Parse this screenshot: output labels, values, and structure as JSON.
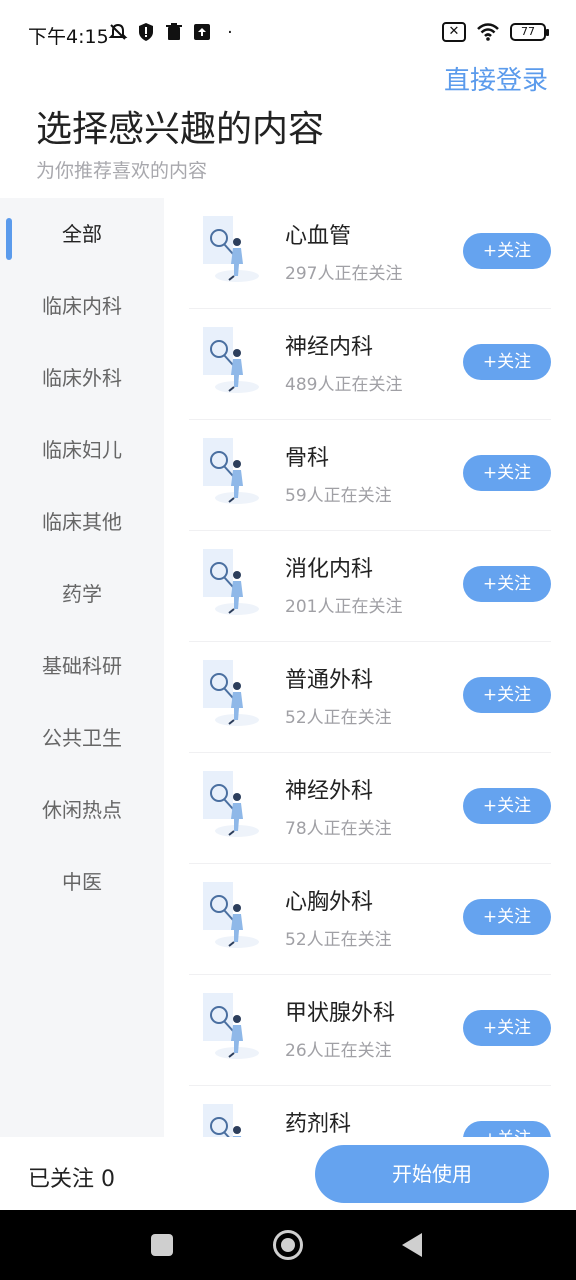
{
  "status_bar": {
    "time": "下午4:15",
    "battery": "77",
    "icons": [
      "muted-bell-icon",
      "shield-alert-icon",
      "trash-icon",
      "upload-icon",
      "dot-icon"
    ],
    "right_icons": [
      "sim-off-icon",
      "wifi-icon",
      "battery-icon"
    ]
  },
  "header": {
    "login_link": "直接登录",
    "title": "选择感兴趣的内容",
    "subtitle": "为你推荐喜欢的内容"
  },
  "sidebar": {
    "items": [
      {
        "label": "全部",
        "active": true
      },
      {
        "label": "临床内科"
      },
      {
        "label": "临床外科"
      },
      {
        "label": "临床妇儿"
      },
      {
        "label": "临床其他"
      },
      {
        "label": "药学"
      },
      {
        "label": "基础科研"
      },
      {
        "label": "公共卫生"
      },
      {
        "label": "休闲热点"
      },
      {
        "label": "中医"
      }
    ]
  },
  "topics": [
    {
      "name": "心血管",
      "count": "297人正在关注",
      "button": "+关注"
    },
    {
      "name": "神经内科",
      "count": "489人正在关注",
      "button": "+关注"
    },
    {
      "name": "骨科",
      "count": "59人正在关注",
      "button": "+关注"
    },
    {
      "name": "消化内科",
      "count": "201人正在关注",
      "button": "+关注"
    },
    {
      "name": "普通外科",
      "count": "52人正在关注",
      "button": "+关注"
    },
    {
      "name": "神经外科",
      "count": "78人正在关注",
      "button": "+关注"
    },
    {
      "name": "心胸外科",
      "count": "52人正在关注",
      "button": "+关注"
    },
    {
      "name": "甲状腺外科",
      "count": "26人正在关注",
      "button": "+关注"
    },
    {
      "name": "药剂科",
      "count": "",
      "button": "+关注"
    }
  ],
  "bottom_bar": {
    "followed_label": "已关注 0",
    "start_button": "开始使用"
  },
  "colors": {
    "accent": "#65a3ef",
    "link": "#5b9bec",
    "sidebar_bg": "#f5f6f8"
  }
}
